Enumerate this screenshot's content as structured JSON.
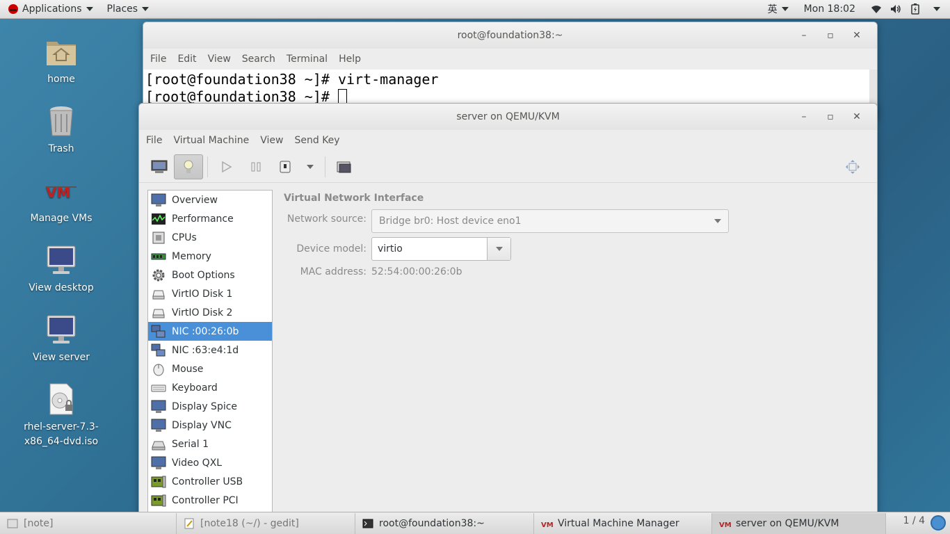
{
  "top_panel": {
    "applications": "Applications",
    "places": "Places",
    "input_method": "英",
    "clock": "Mon 18:02"
  },
  "desktop": {
    "icons": [
      {
        "label": "home"
      },
      {
        "label": "Trash"
      },
      {
        "label": "Manage VMs"
      },
      {
        "label": "View desktop"
      },
      {
        "label": "View server"
      },
      {
        "label_line1": "rhel-server-7.3-",
        "label_line2": "x86_64-dvd.iso"
      }
    ]
  },
  "terminal": {
    "title": "root@foundation38:~",
    "menu": [
      "File",
      "Edit",
      "View",
      "Search",
      "Terminal",
      "Help"
    ],
    "lines": [
      "[root@foundation38 ~]# virt-manager",
      "[root@foundation38 ~]# "
    ]
  },
  "vm_window": {
    "title": "server on QEMU/KVM",
    "menu": [
      "File",
      "Virtual Machine",
      "View",
      "Send Key"
    ],
    "hardware": [
      {
        "label": "Overview",
        "icon": "monitor-icon"
      },
      {
        "label": "Performance",
        "icon": "performance-icon"
      },
      {
        "label": "CPUs",
        "icon": "cpu-icon"
      },
      {
        "label": "Memory",
        "icon": "memory-icon"
      },
      {
        "label": "Boot Options",
        "icon": "gear-icon"
      },
      {
        "label": "VirtIO Disk 1",
        "icon": "disk-icon"
      },
      {
        "label": "VirtIO Disk 2",
        "icon": "disk-icon"
      },
      {
        "label": "NIC :00:26:0b",
        "icon": "network-icon"
      },
      {
        "label": "NIC :63:e4:1d",
        "icon": "network-icon"
      },
      {
        "label": "Mouse",
        "icon": "mouse-icon"
      },
      {
        "label": "Keyboard",
        "icon": "keyboard-icon"
      },
      {
        "label": "Display Spice",
        "icon": "monitor-icon"
      },
      {
        "label": "Display VNC",
        "icon": "monitor-icon"
      },
      {
        "label": "Serial 1",
        "icon": "serial-icon"
      },
      {
        "label": "Video QXL",
        "icon": "monitor-icon"
      },
      {
        "label": "Controller USB",
        "icon": "controller-icon"
      },
      {
        "label": "Controller PCI",
        "icon": "controller-icon"
      }
    ],
    "selected_index": 7,
    "detail": {
      "title": "Virtual Network Interface",
      "network_source_label": "Network source:",
      "network_source_value": "Bridge br0: Host device eno1",
      "device_model_label": "Device model:",
      "device_model_value": "virtio",
      "mac_label": "MAC address:",
      "mac_value": "52:54:00:00:26:0b"
    }
  },
  "taskbar": {
    "tasks": [
      {
        "label": "[note]"
      },
      {
        "label": "[note18 (~/) - gedit]"
      },
      {
        "label": "root@foundation38:~"
      },
      {
        "label": "Virtual Machine Manager"
      },
      {
        "label": "server on QEMU/KVM"
      }
    ],
    "pager": "1 / 4"
  },
  "colors": {
    "selection": "#4a90d9",
    "desktop": "#3277a0"
  }
}
